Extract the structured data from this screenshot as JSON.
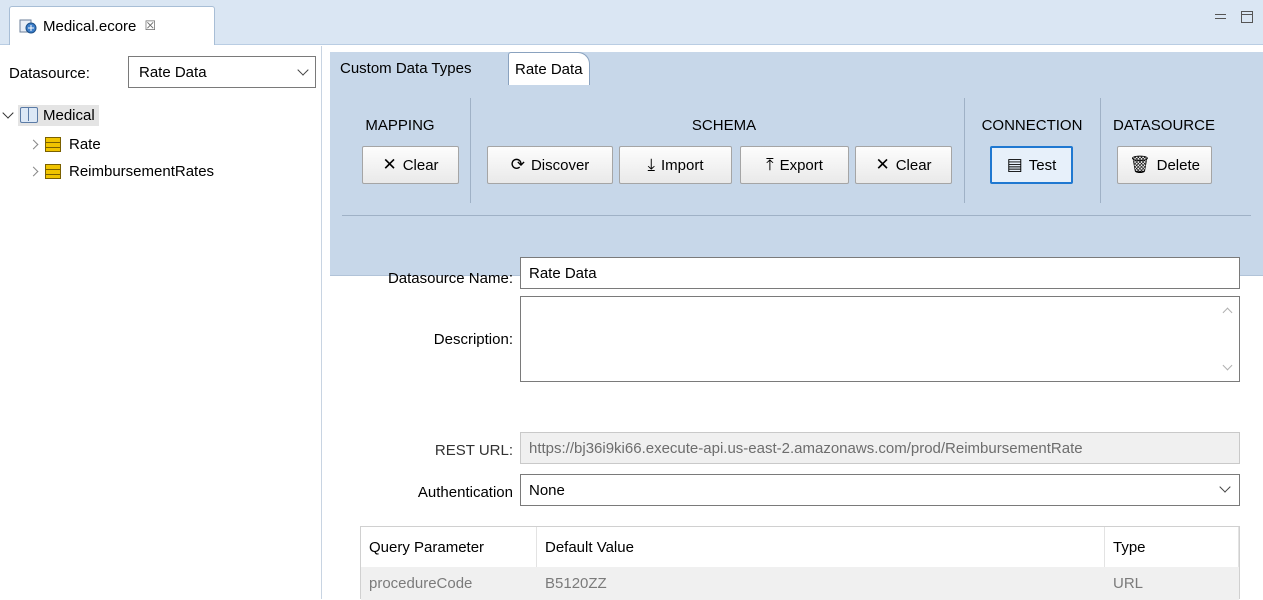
{
  "editor": {
    "tab_title": "Medical.ecore",
    "close_glyph": "☒"
  },
  "left_panel": {
    "datasource_label": "Datasource:",
    "datasource_value": "Rate Data",
    "tree": {
      "root": "Medical",
      "children": [
        "Rate",
        "ReimbursementRates"
      ]
    }
  },
  "sub_tabs": [
    "Custom Data Types",
    "Rate Data"
  ],
  "toolbar": {
    "groups": {
      "mapping": "MAPPING",
      "schema": "SCHEMA",
      "connection": "CONNECTION",
      "datasource": "DATASOURCE"
    },
    "buttons": {
      "mapping_clear": "Clear",
      "discover": "Discover",
      "import": "Import",
      "export": "Export",
      "schema_clear": "Clear",
      "test": "Test",
      "delete": "Delete"
    }
  },
  "form": {
    "name_label": "Datasource Name:",
    "name_value": "Rate Data",
    "description_label": "Description:",
    "description_value": "",
    "rest_url_label": "REST URL:",
    "rest_url_value": "https://bj36i9ki66.execute-api.us-east-2.amazonaws.com/prod/ReimbursementRate",
    "auth_label": "Authentication",
    "auth_value": "None"
  },
  "params_table": {
    "headers": [
      "Query Parameter",
      "Default Value",
      "Type"
    ],
    "rows": [
      [
        "procedureCode",
        "B5120ZZ",
        "URL"
      ]
    ]
  },
  "colors": {
    "toolbar_bg": "#c7d7e9",
    "tab_bar_bg": "#dae6f3",
    "focus_accent": "#1f78d1"
  }
}
